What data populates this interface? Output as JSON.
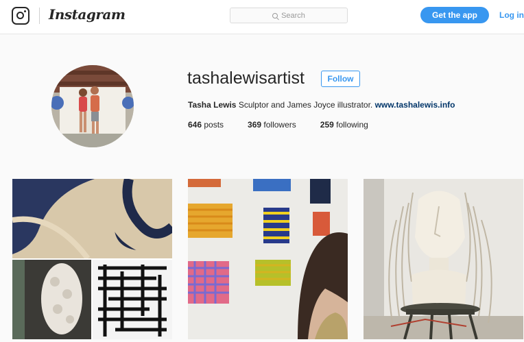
{
  "header": {
    "wordmark": "Instagram",
    "search_placeholder": "Search",
    "get_app_label": "Get the app",
    "login_label": "Log in"
  },
  "profile": {
    "username": "tashalewisartist",
    "follow_label": "Follow",
    "full_name": "Tasha Lewis",
    "bio_text": " Sculptor and James Joyce illustrator. ",
    "website": "www.tashalewis.info",
    "posts_count": "646",
    "posts_label": " posts",
    "followers_count": "369",
    "followers_label": " followers",
    "following_count": "259",
    "following_label": " following"
  },
  "colors": {
    "accent": "#3897f0",
    "link": "#003569"
  }
}
